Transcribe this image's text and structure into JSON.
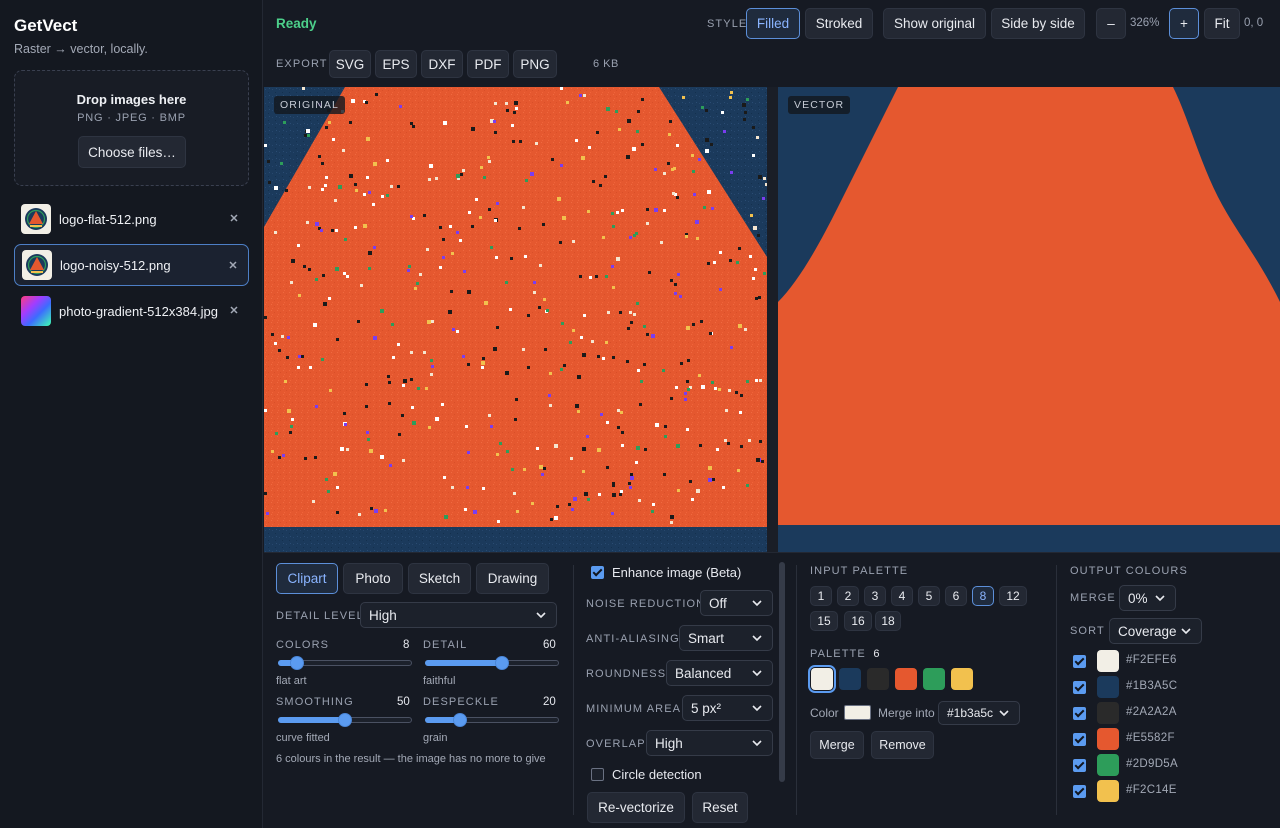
{
  "app": {
    "title": "GetVect",
    "subtitle": "Raster → vector, locally."
  },
  "dropzone": {
    "title": "Drop images here",
    "types": "PNG · JPEG · BMP",
    "choose_label": "Choose files…"
  },
  "files": [
    {
      "name": "logo-flat-512.png"
    },
    {
      "name": "logo-noisy-512.png",
      "selected": true
    },
    {
      "name": "photo-gradient-512x384.jpg"
    }
  ],
  "header": {
    "status": "Ready",
    "style_label": "STYLE",
    "style_options": [
      "Filled",
      "Stroked"
    ],
    "style_selected": "Filled",
    "show_original": "Show original",
    "side_by_side": "Side by side",
    "zoom_out": "–",
    "zoom_level": "326%",
    "zoom_in": "+",
    "fit": "Fit",
    "coords": "0, 0",
    "export_label": "EXPORT",
    "export_formats": [
      "SVG",
      "EPS",
      "DXF",
      "PDF",
      "PNG"
    ],
    "file_size": "6 KB"
  },
  "viewer": {
    "original_label": "ORIGINAL",
    "vector_label": "VECTOR"
  },
  "presets": {
    "options": [
      "Clipart",
      "Photo",
      "Sketch",
      "Drawing"
    ],
    "selected": "Clipart"
  },
  "controls": {
    "detail_level_label": "DETAIL LEVEL",
    "detail_level_value": "High",
    "colors": {
      "label": "COLORS",
      "value": "8",
      "hint": "flat art",
      "fraction": 0.1
    },
    "detail": {
      "label": "DETAIL",
      "value": "60",
      "hint": "faithful",
      "fraction": 0.58
    },
    "smoothing": {
      "label": "SMOOTHING",
      "value": "50",
      "hint": "curve fitted",
      "fraction": 0.5
    },
    "despeckle": {
      "label": "DESPECKLE",
      "value": "20",
      "hint": "grain",
      "fraction": 0.23
    },
    "note": "6 colours in the result — the image has no more to give"
  },
  "enhance": {
    "enhance_label": "Enhance image (Beta)",
    "noise_reduction_label": "NOISE REDUCTION",
    "noise_reduction_value": "Off",
    "anti_aliasing_label": "ANTI-ALIASING",
    "anti_aliasing_value": "Smart",
    "roundness_label": "ROUNDNESS",
    "roundness_value": "Balanced",
    "minimum_area_label": "MINIMUM AREA",
    "minimum_area_value": "5 px²",
    "overlap_label": "OVERLAP",
    "overlap_value": "High",
    "circle_detection_label": "Circle detection",
    "revectorize_label": "Re-vectorize",
    "reset_label": "Reset"
  },
  "input_palette": {
    "label": "INPUT PALETTE",
    "options": [
      "1",
      "2",
      "3",
      "4",
      "5",
      "6",
      "8",
      "12",
      "15",
      "16",
      "18"
    ],
    "selected": "8",
    "palette_label": "PALETTE",
    "palette_count": "6",
    "swatches": [
      "#F2EFE6",
      "#1B3A5C",
      "#2A2A2A",
      "#E5582F",
      "#2D9D5A",
      "#F2C14E"
    ],
    "color_label": "Color",
    "merge_into_label": "Merge into",
    "merge_into_value": "#1b3a5c",
    "merge_label": "Merge",
    "remove_label": "Remove"
  },
  "output": {
    "label": "OUTPUT COLOURS",
    "merge_label": "MERGE",
    "merge_value": "0%",
    "sort_label": "SORT",
    "sort_value": "Coverage",
    "colours": [
      "#F2EFE6",
      "#1B3A5C",
      "#2A2A2A",
      "#E5582F",
      "#2D9D5A",
      "#F2C14E"
    ]
  },
  "colors": {
    "accent": "#5B9BF0",
    "status_ok": "#4CCF8A",
    "orange": "#E5582F",
    "navy": "#1B3A5C"
  }
}
